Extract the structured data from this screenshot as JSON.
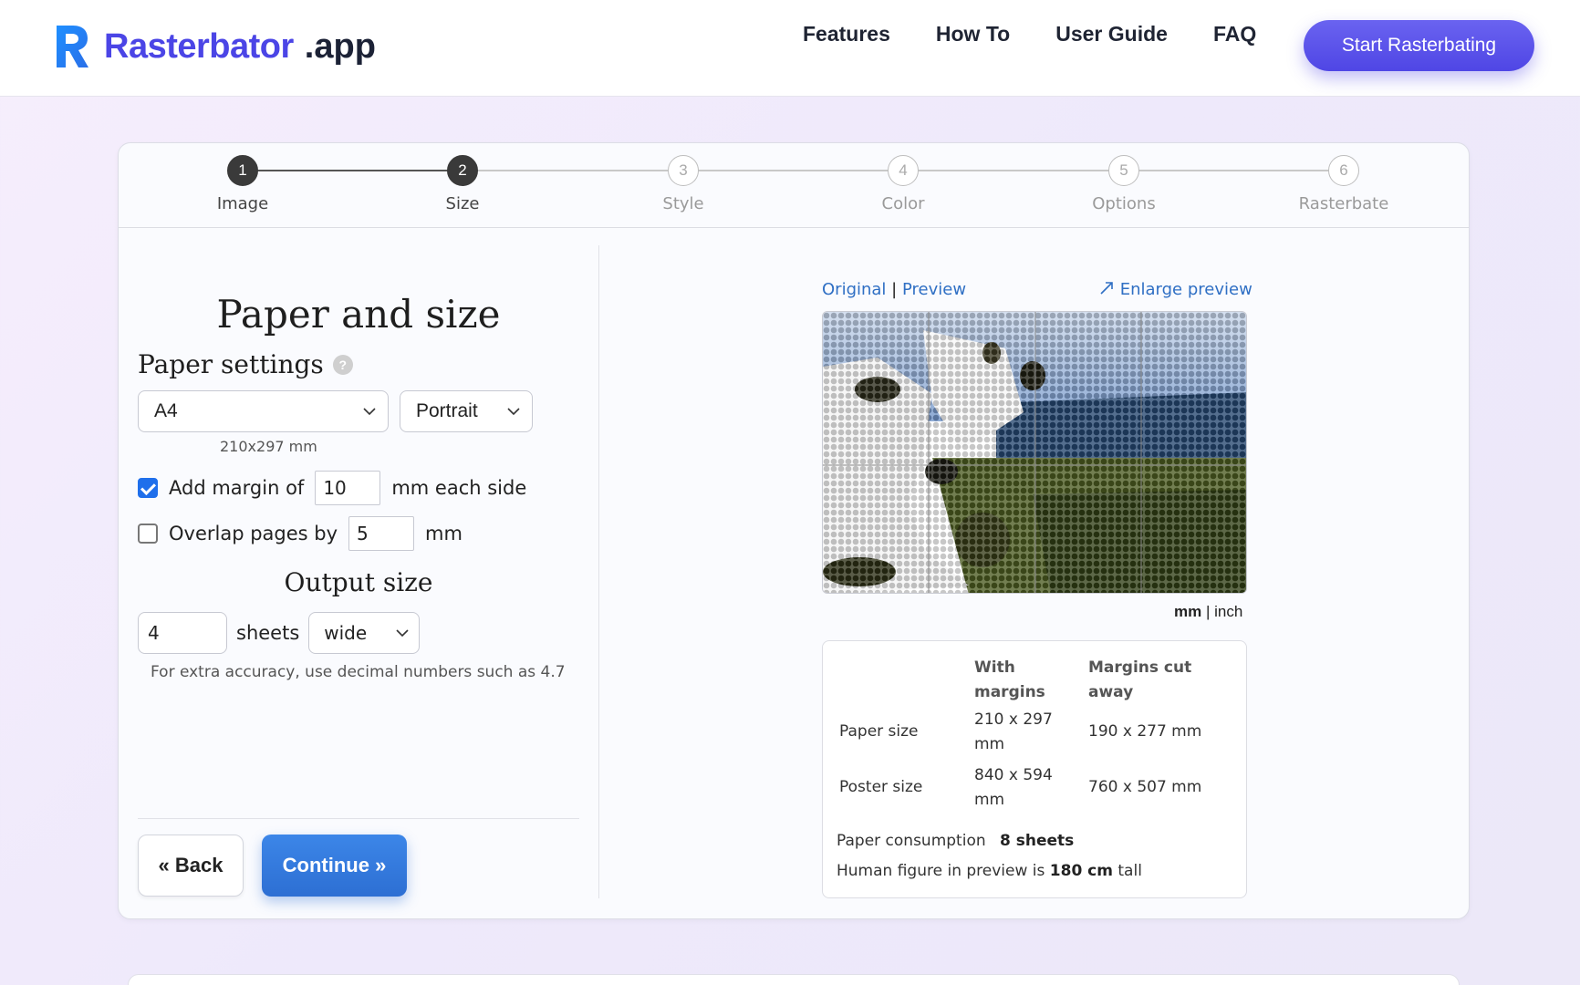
{
  "brand": {
    "name": "Rasterbator",
    "tld": ".app"
  },
  "nav": {
    "items": [
      "Features",
      "How To",
      "User Guide",
      "FAQ"
    ],
    "cta": "Start Rasterbating"
  },
  "steps": [
    {
      "number": "1",
      "label": "Image",
      "state": "done"
    },
    {
      "number": "2",
      "label": "Size",
      "state": "done"
    },
    {
      "number": "3",
      "label": "Style",
      "state": "todo"
    },
    {
      "number": "4",
      "label": "Color",
      "state": "todo"
    },
    {
      "number": "5",
      "label": "Options",
      "state": "todo"
    },
    {
      "number": "6",
      "label": "Rasterbate",
      "state": "todo"
    }
  ],
  "left": {
    "title": "Paper and size",
    "paper_settings": "Paper settings",
    "paper_size": "A4",
    "paper_dims": "210x297 mm",
    "orientation": "Portrait",
    "margin": {
      "label": "Add margin of",
      "value": "10",
      "suffix": "mm each side",
      "checked": true
    },
    "overlap": {
      "label": "Overlap pages by",
      "value": "5",
      "suffix": "mm",
      "checked": false
    },
    "output_title": "Output size",
    "sheets_value": "4",
    "sheets_label": "sheets",
    "dimension": "wide",
    "accuracy_hint": "For extra accuracy, use decimal numbers such as 4.7",
    "back": "« Back",
    "continue": "Continue »"
  },
  "right": {
    "tab_original": "Original",
    "tab_separator": "|",
    "tab_preview": "Preview",
    "enlarge": "Enlarge preview",
    "unit_mm": "mm",
    "unit_sep": "|",
    "unit_inch": "inch",
    "table": {
      "head_with": [
        "With",
        "margins"
      ],
      "head_cut": [
        "Margins cut",
        "away"
      ],
      "paper_label": "Paper size",
      "paper_with": [
        "210 x 297",
        "mm"
      ],
      "paper_cut": "190 x 277 mm",
      "poster_label": "Poster size",
      "poster_with": [
        "840 x 594",
        "mm"
      ],
      "poster_cut": "760 x 507 mm"
    },
    "consumption_label": "Paper consumption",
    "consumption_value": "8 sheets",
    "figure_prefix": "Human figure in preview is",
    "figure_value": "180 cm",
    "figure_suffix": "tall"
  },
  "colors": {
    "brand": "#4b45e6",
    "accent": "#1f6feb",
    "cta": "#4f46e5"
  }
}
